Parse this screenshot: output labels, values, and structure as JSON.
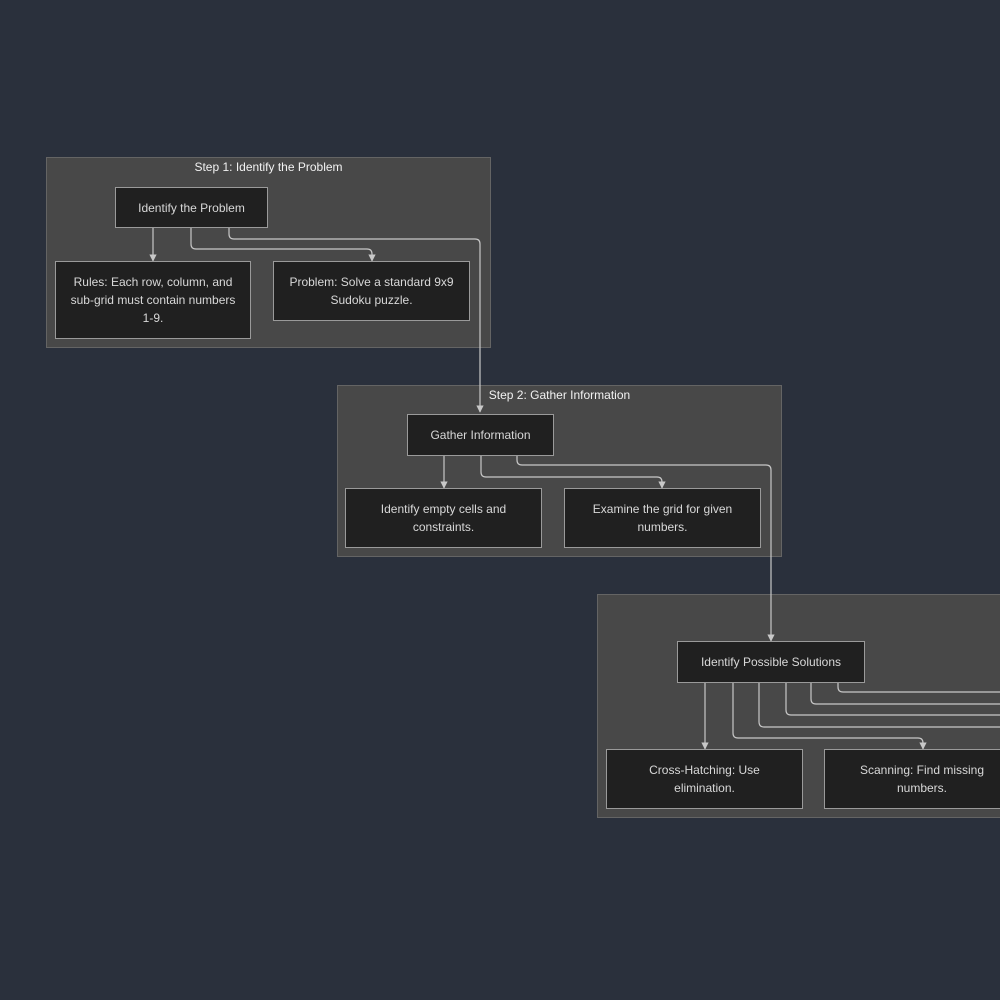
{
  "clusters": {
    "step1": {
      "title": "Step 1: Identify the Problem"
    },
    "step2": {
      "title": "Step 2: Gather Information"
    },
    "step3": {
      "title": ""
    }
  },
  "nodes": {
    "identify_problem": "Identify the Problem",
    "rules": "Rules: Each row, column, and sub-grid must contain numbers 1-9.",
    "problem": "Problem: Solve a standard 9x9 Sudoku puzzle.",
    "gather_information": "Gather Information",
    "identify_empty_cells": "Identify empty cells and constraints.",
    "examine_grid": "Examine the grid for given numbers.",
    "identify_solutions": "Identify Possible Solutions",
    "cross_hatching": "Cross-Hatching: Use elimination.",
    "scanning": "Scanning: Find missing numbers."
  },
  "colors": {
    "background": "#2a303c",
    "cluster_fill": "#484848",
    "node_fill": "#202020",
    "edge": "#c8c8c8"
  }
}
